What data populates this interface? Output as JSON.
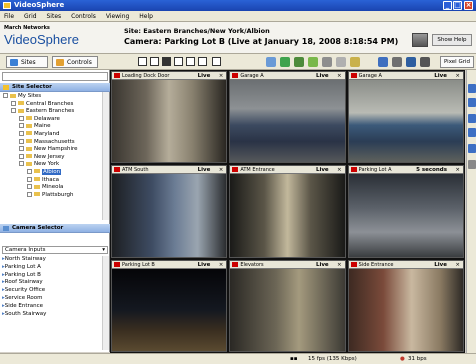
{
  "window": {
    "title": "VideoSphere"
  },
  "menu": [
    "File",
    "Grid",
    "Sites",
    "Controls",
    "Viewing",
    "Help"
  ],
  "header": {
    "brand_small": "March Networks",
    "brand": "VideoSphere",
    "site_path": "Site: Eastern Branches/New York/Albion",
    "camera_line": "Camera: Parking Lot B (Live at January 18, 2008 8:18:54 PM)",
    "help_label": "Show Help"
  },
  "toolbar": {
    "tabs": [
      {
        "label": "Sites",
        "icon": "globe-icon"
      },
      {
        "label": "Controls",
        "icon": "controls-icon"
      }
    ],
    "pixel_grid": "Pixel Grid"
  },
  "site_selector": {
    "title": "Site Selector",
    "tree": [
      {
        "label": "My Sites",
        "depth": 0
      },
      {
        "label": "Central Branches",
        "depth": 1
      },
      {
        "label": "Eastern Branches",
        "depth": 1
      },
      {
        "label": "Delaware",
        "depth": 2
      },
      {
        "label": "Maine",
        "depth": 2
      },
      {
        "label": "Maryland",
        "depth": 2
      },
      {
        "label": "Massachusetts",
        "depth": 2
      },
      {
        "label": "New Hampshire",
        "depth": 2
      },
      {
        "label": "New Jersey",
        "depth": 2
      },
      {
        "label": "New York",
        "depth": 2
      },
      {
        "label": "Albion",
        "depth": 3,
        "selected": true
      },
      {
        "label": "Ithaca",
        "depth": 3
      },
      {
        "label": "Mineola",
        "depth": 3
      },
      {
        "label": "Plattsburgh",
        "depth": 3
      }
    ]
  },
  "camera_selector": {
    "title": "Camera Selector",
    "dropdown": "Camera Inputs",
    "cameras": [
      "North Stairway",
      "Parking Lot A",
      "Parking Lot B",
      "Roof Stairway",
      "Security Office",
      "Service Room",
      "Side Entrance",
      "South Stairway"
    ]
  },
  "grid_cells": [
    {
      "name": "Loading Dock Door",
      "status": "Live",
      "scene": "dock"
    },
    {
      "name": "Garage A",
      "status": "Live",
      "scene": "garage"
    },
    {
      "name": "Garage A",
      "status": "Live",
      "scene": "garage2"
    },
    {
      "name": "ATM South",
      "status": "Live",
      "scene": "atm"
    },
    {
      "name": "ATM Entrance",
      "status": "Live",
      "scene": "corridor"
    },
    {
      "name": "Parking Lot A",
      "status": "5 seconds",
      "scene": "lotA"
    },
    {
      "name": "Parking Lot B",
      "status": "Live",
      "scene": "lotB"
    },
    {
      "name": "Elevators",
      "status": "Live",
      "scene": "elevators"
    },
    {
      "name": "Side Entrance",
      "status": "Live",
      "scene": "entrance"
    }
  ],
  "status": {
    "fps": "15 fps (135 Kbps)",
    "rate": "31 bps"
  }
}
